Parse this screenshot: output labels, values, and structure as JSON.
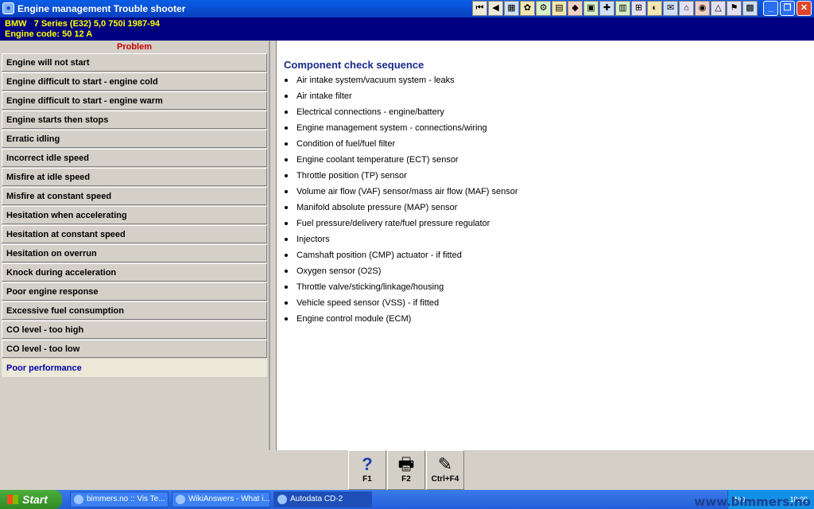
{
  "window": {
    "title": "Engine management Trouble shooter",
    "toolbar_icons": [
      "first-icon",
      "prev-icon",
      "tool-icon-1",
      "tool-icon-2",
      "tool-icon-3",
      "tool-icon-4",
      "tool-icon-5",
      "tool-icon-6",
      "tool-icon-7",
      "tool-icon-8",
      "tool-icon-9",
      "tool-icon-10",
      "tool-icon-11",
      "tool-icon-12",
      "tool-icon-13",
      "tool-icon-14",
      "tool-icon-15",
      "tool-icon-16"
    ],
    "controls": [
      "minimize-icon",
      "restore-icon",
      "close-icon"
    ]
  },
  "vehicle": {
    "line1": "BMW   7 Series (E32) 5,0 750i 1987-94",
    "line2": "Engine code: 50 12 A"
  },
  "problems": {
    "header": "Problem",
    "items": [
      "Engine will not start",
      "Engine difficult to start - engine cold",
      "Engine difficult to start - engine warm",
      "Engine starts then stops",
      "Erratic idling",
      "Incorrect idle speed",
      "Misfire at idle speed",
      "Misfire at constant speed",
      "Hesitation when accelerating",
      "Hesitation at constant speed",
      "Hesitation on overrun",
      "Knock during acceleration",
      "Poor engine response",
      "Excessive fuel consumption",
      "CO level - too high",
      "CO level - too low",
      "Poor performance"
    ],
    "selected": "Poor performance"
  },
  "content": {
    "heading": "Component check sequence",
    "items": [
      "Air intake system/vacuum system - leaks",
      "Air intake filter",
      "Electrical connections - engine/battery",
      "Engine management system - connections/wiring",
      "Condition of fuel/fuel filter",
      "Engine coolant temperature (ECT) sensor",
      "Throttle position (TP) sensor",
      "Volume air flow (VAF) sensor/mass air flow (MAF) sensor",
      "Manifold absolute pressure (MAP) sensor",
      "Fuel pressure/delivery rate/fuel pressure regulator",
      "Injectors",
      "Camshaft position (CMP) actuator - if fitted",
      "Oxygen sensor (O2S)",
      "Throttle valve/sticking/linkage/housing",
      "Vehicle speed sensor (VSS) - if fitted",
      "Engine control module (ECM)"
    ]
  },
  "function_keys": [
    {
      "label": "F1",
      "icon": "help-icon"
    },
    {
      "label": "F2",
      "icon": "printer-icon"
    },
    {
      "label": "Ctrl+F4",
      "icon": "notes-icon"
    }
  ],
  "taskbar": {
    "start_label": "Start",
    "tasks": [
      "bimmers.no :: Vis Te...",
      "WikiAnswers - What i...",
      "Autodata CD-2"
    ],
    "tray_lang": "NO",
    "clock": "18:09"
  },
  "watermark": "www.bimmers.no"
}
